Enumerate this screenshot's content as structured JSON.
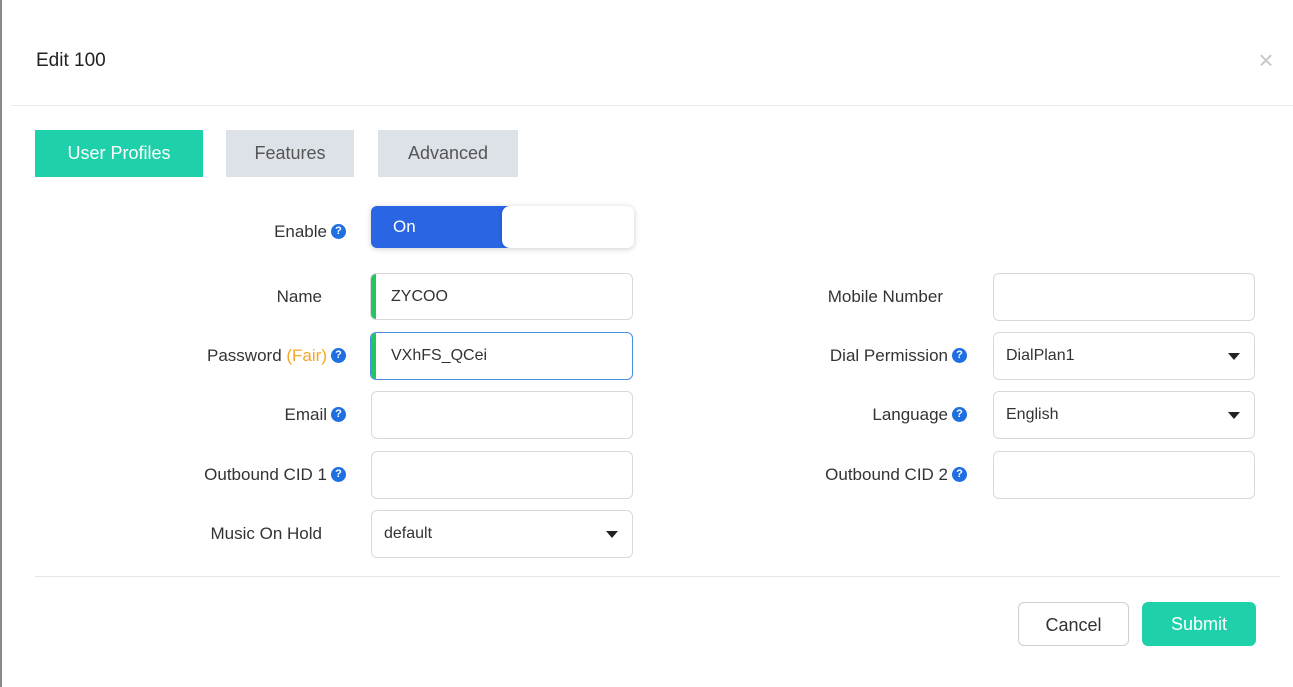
{
  "modal": {
    "title": "Edit 100",
    "close_glyph": "×"
  },
  "tabs": [
    {
      "label": "User Profiles",
      "active": true
    },
    {
      "label": "Features",
      "active": false
    },
    {
      "label": "Advanced",
      "active": false
    }
  ],
  "form": {
    "enable": {
      "label": "Enable",
      "state": "On"
    },
    "name": {
      "label": "Name",
      "value": "ZYCOO"
    },
    "password": {
      "label": "Password",
      "strength": "(Fair)",
      "value": "VXhFS_QCei"
    },
    "email": {
      "label": "Email",
      "value": ""
    },
    "outbound_cid_1": {
      "label": "Outbound CID 1",
      "value": ""
    },
    "music_on_hold": {
      "label": "Music On Hold",
      "value": "default"
    },
    "mobile_number": {
      "label": "Mobile Number",
      "value": ""
    },
    "dial_permission": {
      "label": "Dial Permission",
      "value": "DialPlan1"
    },
    "language": {
      "label": "Language",
      "value": "English"
    },
    "outbound_cid_2": {
      "label": "Outbound CID 2",
      "value": ""
    }
  },
  "help_glyph": "?",
  "footer": {
    "cancel_label": "Cancel",
    "submit_label": "Submit"
  },
  "colors": {
    "accent": "#1fd1aa",
    "toggle_blue": "#2a65e3",
    "help_blue": "#1f6fe0",
    "fair_orange": "#f5a623",
    "valid_green": "#22c55e"
  }
}
